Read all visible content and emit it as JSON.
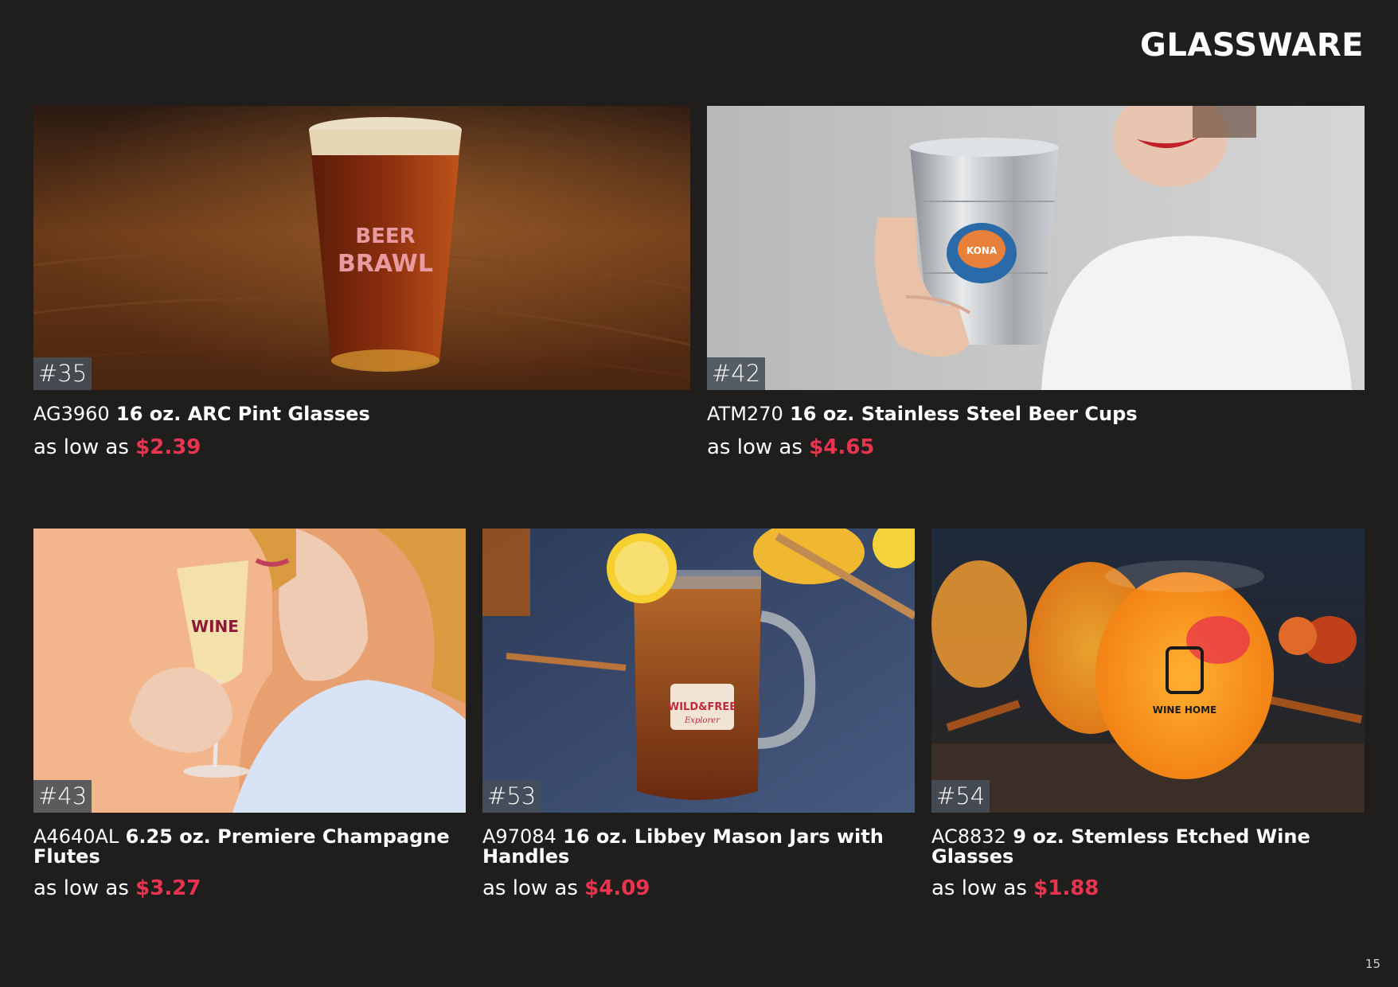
{
  "page": {
    "title": "GLASSWARE",
    "page_number": "15",
    "price_prefix": "as low as",
    "accent_color": "#e8344e",
    "background": "#1f1e1d"
  },
  "products": [
    {
      "tag": "#35",
      "code": "AG3960",
      "name": "16 oz. ARC Pint Glasses",
      "price": "$2.39",
      "imprint": [
        "BEER",
        "BRAWL"
      ]
    },
    {
      "tag": "#42",
      "code": "ATM270",
      "name": "16 oz. Stainless Steel Beer Cups",
      "price": "$4.65",
      "imprint": [
        "KONA"
      ]
    },
    {
      "tag": "#43",
      "code": "A4640AL",
      "name": "6.25 oz. Premiere Champagne Flutes",
      "price": "$3.27",
      "imprint": [
        "WINE"
      ]
    },
    {
      "tag": "#53",
      "code": "A97084",
      "name": "16 oz. Libbey Mason Jars with Handles",
      "price": "$4.09",
      "imprint": [
        "WILD&FREE",
        "Explorer"
      ]
    },
    {
      "tag": "#54",
      "code": "AC8832",
      "name": "9 oz. Stemless Etched Wine Glasses",
      "price": "$1.88",
      "imprint": [
        "WINE HOME"
      ]
    }
  ]
}
